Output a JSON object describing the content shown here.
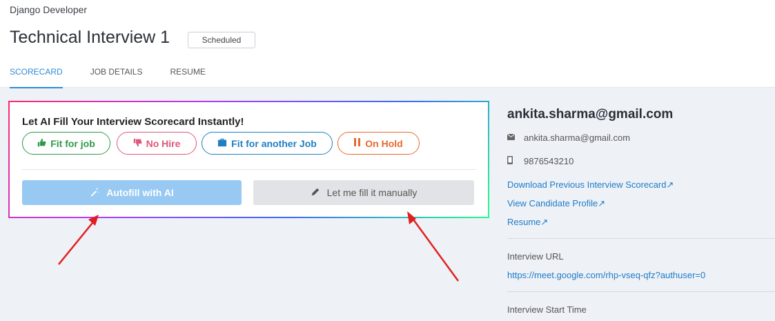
{
  "header": {
    "job_title": "Django Developer",
    "interview_title": "Technical Interview 1",
    "status": "Scheduled",
    "tabs": [
      {
        "label": "SCORECARD"
      },
      {
        "label": "JOB DETAILS"
      },
      {
        "label": "RESUME"
      }
    ]
  },
  "ai_panel": {
    "title": "Let AI Fill Your Interview Scorecard Instantly!",
    "options": {
      "fit": {
        "label": "Fit for job",
        "icon": "thumbs-up-icon",
        "color": "#2c9a48"
      },
      "no_hire": {
        "label": "No Hire",
        "icon": "thumbs-down-icon",
        "color": "#e0567a"
      },
      "another": {
        "label": "Fit for another Job",
        "icon": "briefcase-icon",
        "color": "#1f7ec4"
      },
      "hold": {
        "label": "On Hold",
        "icon": "pause-icon",
        "color": "#e9682b"
      }
    },
    "autofill_label": "Autofill with AI",
    "manual_label": "Let me fill it manually"
  },
  "candidate": {
    "email_heading": "ankita.sharma@gmail.com",
    "email": "ankita.sharma@gmail.com",
    "phone": "9876543210",
    "links": {
      "download": "Download Previous Interview Scorecard↗",
      "profile": "View Candidate Profile↗",
      "resume": "Resume↗"
    },
    "interview_url_label": "Interview URL",
    "interview_url": "https://meet.google.com/rhp-vseq-qfz?authuser=0",
    "start_time_label": "Interview Start Time"
  }
}
